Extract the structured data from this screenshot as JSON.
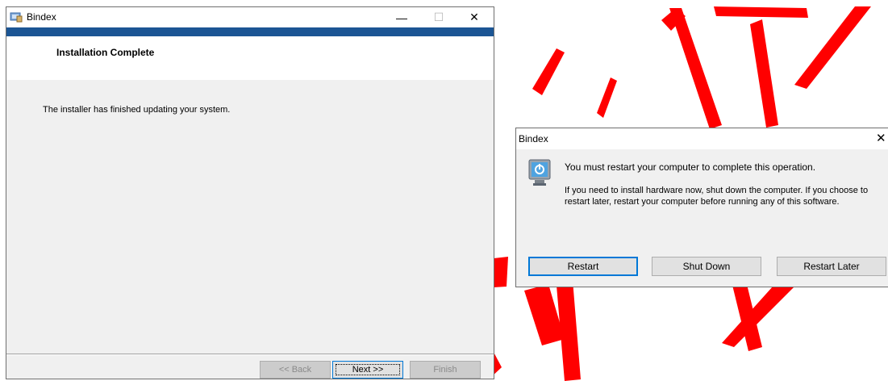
{
  "installer": {
    "title": "Bindex",
    "header_title": "Installation Complete",
    "message": "The installer has finished updating your system.",
    "buttons": {
      "back": "<< Back",
      "next": "Next >>",
      "finish": "Finish"
    },
    "window_controls": {
      "minimize": "—",
      "maximize": "☐",
      "close": "✕"
    }
  },
  "dialog": {
    "title": "Bindex",
    "close": "✕",
    "main_text": "You must restart your computer to complete this operation.",
    "sub_text": "If you need to install hardware now, shut down the computer. If you choose to restart later, restart your computer before running any of this software.",
    "buttons": {
      "restart": "Restart",
      "shut_down": "Shut Down",
      "restart_later": "Restart Later"
    }
  },
  "colors": {
    "header_band": "#1b5594",
    "overlay_stroke": "#ff0000",
    "focus_border": "#0078d7"
  },
  "icons": [
    "installer-app-icon",
    "restart-power-icon"
  ]
}
